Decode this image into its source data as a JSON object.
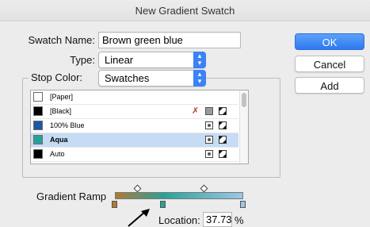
{
  "window": {
    "title": "New Gradient Swatch"
  },
  "swatch_name": {
    "label": "Swatch Name:",
    "value": "Brown green blue"
  },
  "type": {
    "label": "Type:",
    "value": "Linear"
  },
  "stop_color": {
    "label": "Stop Color:",
    "value": "Swatches"
  },
  "swatches": [
    {
      "name": "[Paper]",
      "color": "#ffffff"
    },
    {
      "name": "[Black]",
      "color": "#000000"
    },
    {
      "name": "100% Blue",
      "color": "#1d57a6"
    },
    {
      "name": "Aqua",
      "color": "#2aa198"
    },
    {
      "name": "Auto",
      "color": "#000000"
    }
  ],
  "gradient_ramp": {
    "label": "Gradient Ramp",
    "colors": [
      "#b07a33",
      "#2aa198",
      "#9ec6e8"
    ],
    "stop_positions_pct": [
      0,
      37.73,
      100
    ],
    "midpoint_positions_pct": [
      18,
      70
    ]
  },
  "location": {
    "label": "Location:",
    "value": "37.73",
    "unit": "%"
  },
  "buttons": {
    "ok": "OK",
    "cancel": "Cancel",
    "add": "Add"
  },
  "icons": [
    "pencil-strike-icon",
    "color-mode-icon",
    "no-print-icon",
    "arrow-annotation-icon",
    "stepper-arrows-icon"
  ]
}
